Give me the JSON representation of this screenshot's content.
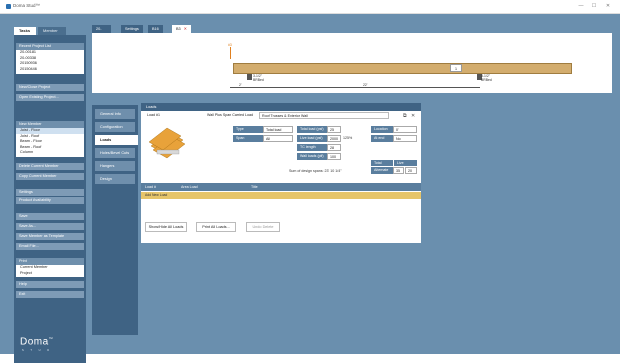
{
  "window": {
    "title": "Doma Stud™",
    "min": "—",
    "max": "☐",
    "close": "✕"
  },
  "left_tabs": {
    "tasks": "Tasks",
    "member": "Member"
  },
  "recent_projects": {
    "header": "Recent Project List",
    "items": [
      "20-00181",
      "20-00338",
      "20150936",
      "20150446"
    ]
  },
  "project_buttons": [
    "New/Close Project",
    "Open Existing Project..."
  ],
  "new_member": {
    "header": "New Member",
    "items": [
      "Joist - Floor",
      "Joist - Roof",
      "Beam - Floor",
      "Beam - Roof",
      "Column"
    ]
  },
  "member_buttons": [
    "Delete Current Member",
    "Copy Current Member"
  ],
  "settings_buttons": [
    "Settings",
    "Product Availability"
  ],
  "save_buttons": [
    "Save",
    "Save As...",
    "Save Member as Template",
    "Email File..."
  ],
  "print": {
    "header": "Print",
    "items": [
      "Current Member",
      "Project"
    ]
  },
  "help_buttons": [
    "Help",
    "Exit"
  ],
  "logo": {
    "text": "Doma",
    "tm": "™",
    "sub": "S T U D"
  },
  "top_tabs": [
    {
      "label": "20-00180"
    },
    {
      "label": "Settings"
    },
    {
      "label": "B16"
    },
    {
      "label": "B3",
      "close": "✕"
    }
  ],
  "diagram": {
    "beam_label": "1",
    "left_support": "3-1/2\"\nBRBed",
    "right_support": "3-1/2\"\nBRBed",
    "span": "22'",
    "left_dim": "2'",
    "marker": "#3"
  },
  "side_menu": [
    "General Info",
    "Configuration",
    "Loads",
    "Holes/Bevel Cuts",
    "Hangers",
    "Design"
  ],
  "loads": {
    "header": "Loads",
    "load_name": "Load #1",
    "load_desc": "Wall Plus Span Carried Load",
    "load_source": "Roof Trusses & Exterior Wall",
    "fields": {
      "type_label": "Type",
      "type_value": "Total load",
      "span_label": "Span",
      "span_value": "All",
      "total_load_label": "Total load (psf)",
      "total_load_value": "25",
      "live_load_label": "Live load (psf)",
      "live_load_value": "2000",
      "live_load_pct": "125%",
      "tc_length_label": "TC length",
      "tc_length_value": "28",
      "wall_loads_label": "Wall loads (plf)",
      "wall_loads_value": "100",
      "location_label": "Location",
      "location_value": "0'",
      "at_end_label": "At end",
      "at_end_value": "No",
      "total_head": "Total",
      "live_head": "Live",
      "alt_ratio_label": "Alternate ratio",
      "alt_total": "35",
      "alt_live": "20"
    },
    "sum_text": "Sum of design spans: 23' 10 1/4\"",
    "table_headers": {
      "load": "Load #",
      "area": "Area Load",
      "title": "Title"
    },
    "add_row": "Add New Load"
  },
  "bottom_buttons": {
    "show_hide": "Show/Hide All Loads",
    "print_all": "Print All Loads...",
    "undo": "Undo Delete"
  },
  "colors": {
    "panel": "#3f6384",
    "bg": "#6a8fae",
    "beam": "#d3ad6e",
    "add_row": "#e6c56a"
  }
}
